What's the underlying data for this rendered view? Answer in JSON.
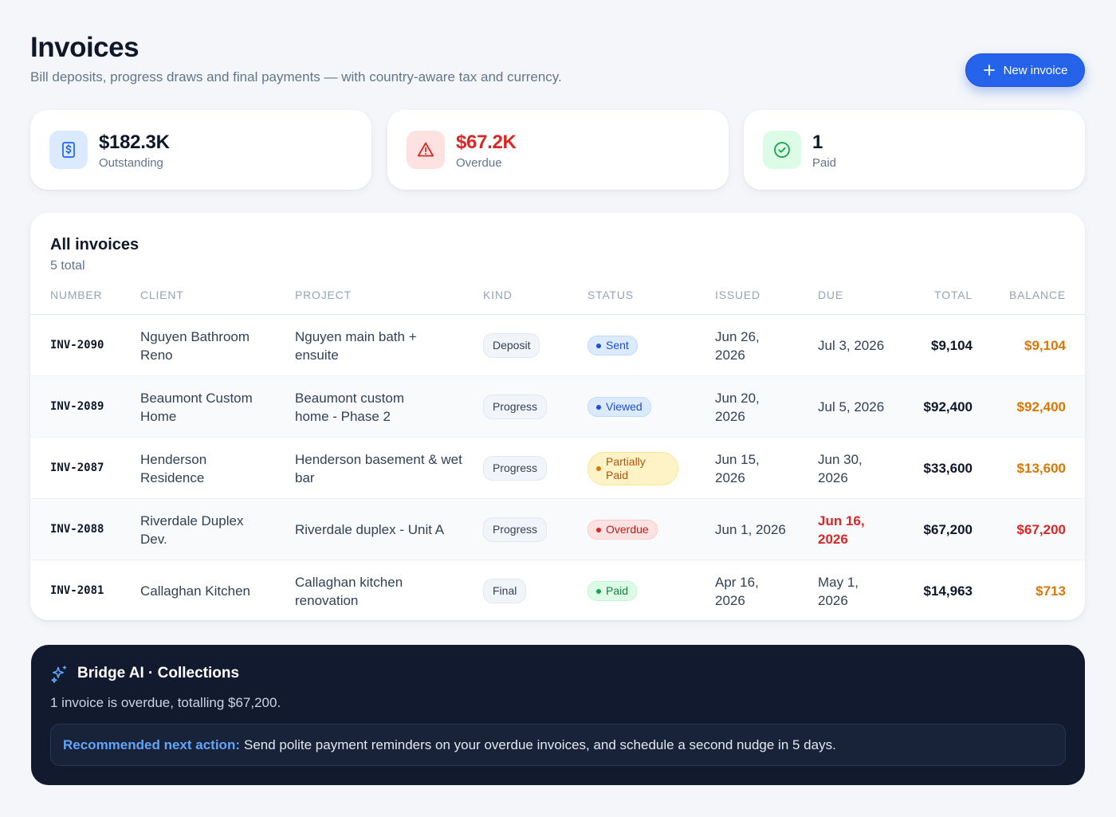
{
  "header": {
    "title": "Invoices",
    "subtitle": "Bill deposits, progress draws and final payments — with country-aware tax and currency.",
    "new_invoice_label": "New invoice"
  },
  "stats": [
    {
      "value": "$182.3K",
      "label": "Outstanding",
      "icon": "dollar-receipt-icon",
      "color": "#0f172a"
    },
    {
      "value": "$67.2K",
      "label": "Overdue",
      "icon": "warning-triangle-icon",
      "color": "#dc2626"
    },
    {
      "value": "1",
      "label": "Paid",
      "icon": "check-circle-icon",
      "color": "#0f172a"
    }
  ],
  "invoices": {
    "title": "All invoices",
    "count": "5 total",
    "columns": [
      "Number",
      "Client",
      "Project",
      "Kind",
      "Status",
      "Issued",
      "Due",
      "Total",
      "Balance"
    ],
    "rows": [
      {
        "number": "INV-2090",
        "client": "Nguyen Bathroom Reno",
        "project": "Nguyen main bath + ensuite",
        "kind": "Deposit",
        "status": "Sent",
        "issued": "Jun 26, 2026",
        "due": "Jul 3, 2026",
        "total": "$9,104",
        "balance": "$9,104"
      },
      {
        "number": "INV-2089",
        "client": "Beaumont Custom Home",
        "project": "Beaumont custom home - Phase 2",
        "kind": "Progress",
        "status": "Viewed",
        "issued": "Jun 20, 2026",
        "due": "Jul 5, 2026",
        "total": "$92,400",
        "balance": "$92,400"
      },
      {
        "number": "INV-2087",
        "client": "Henderson Residence",
        "project": "Henderson basement & wet bar",
        "kind": "Progress",
        "status": "Partially Paid",
        "issued": "Jun 15, 2026",
        "due": "Jun 30, 2026",
        "total": "$33,600",
        "balance": "$13,600"
      },
      {
        "number": "INV-2088",
        "client": "Riverdale Duplex Dev.",
        "project": "Riverdale duplex - Unit A",
        "kind": "Progress",
        "status": "Overdue",
        "issued": "Jun 1, 2026",
        "due": "Jun 16, 2026",
        "total": "$67,200",
        "balance": "$67,200"
      },
      {
        "number": "INV-2081",
        "client": "Callaghan Kitchen",
        "project": "Callaghan kitchen renovation",
        "kind": "Final",
        "status": "Paid",
        "issued": "Apr 16, 2026",
        "due": "May 1, 2026",
        "total": "$14,963",
        "balance": "$713"
      }
    ]
  },
  "ai": {
    "title": "Bridge AI · Collections",
    "summary": "1 invoice is overdue, totalling $67,200.",
    "recommendation_label": "Recommended next action:",
    "recommendation_text": "Send polite payment reminders on your overdue invoices, and schedule a second nudge in 5 days."
  },
  "colors": {
    "accent": "#2563eb",
    "overdue": "#dc2626",
    "balance": "#d97706",
    "ai_panel": "#111a2e"
  }
}
